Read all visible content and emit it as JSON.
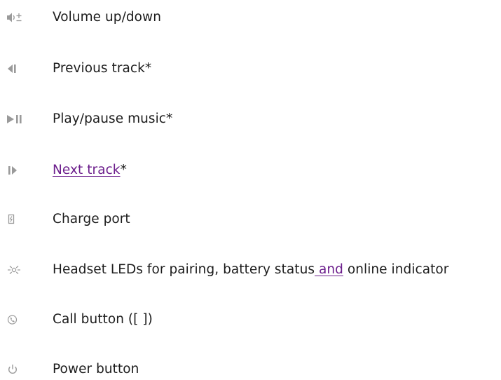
{
  "legend": {
    "items": [
      {
        "icon": "volume-up-down-icon",
        "label": "Volume up/down"
      },
      {
        "icon": "previous-track-icon",
        "label": "Previous track*"
      },
      {
        "icon": "play-pause-icon",
        "label": "Play/pause music*"
      },
      {
        "icon": "next-track-icon",
        "link": "Next track",
        "suffix": "*"
      },
      {
        "icon": "charge-port-icon",
        "label": "Charge port"
      },
      {
        "icon": "led-icon",
        "prefix": "Headset LEDs for pairing, battery status",
        "link": " and",
        "suffix": " online indicator"
      },
      {
        "icon": "call-icon",
        "label": "Call button ([ ])"
      },
      {
        "icon": "power-icon",
        "label": "Power button"
      }
    ]
  },
  "colors": {
    "text": "#1c1c1c",
    "icon": "#9a9a9a",
    "link": "#6c1e8c"
  }
}
